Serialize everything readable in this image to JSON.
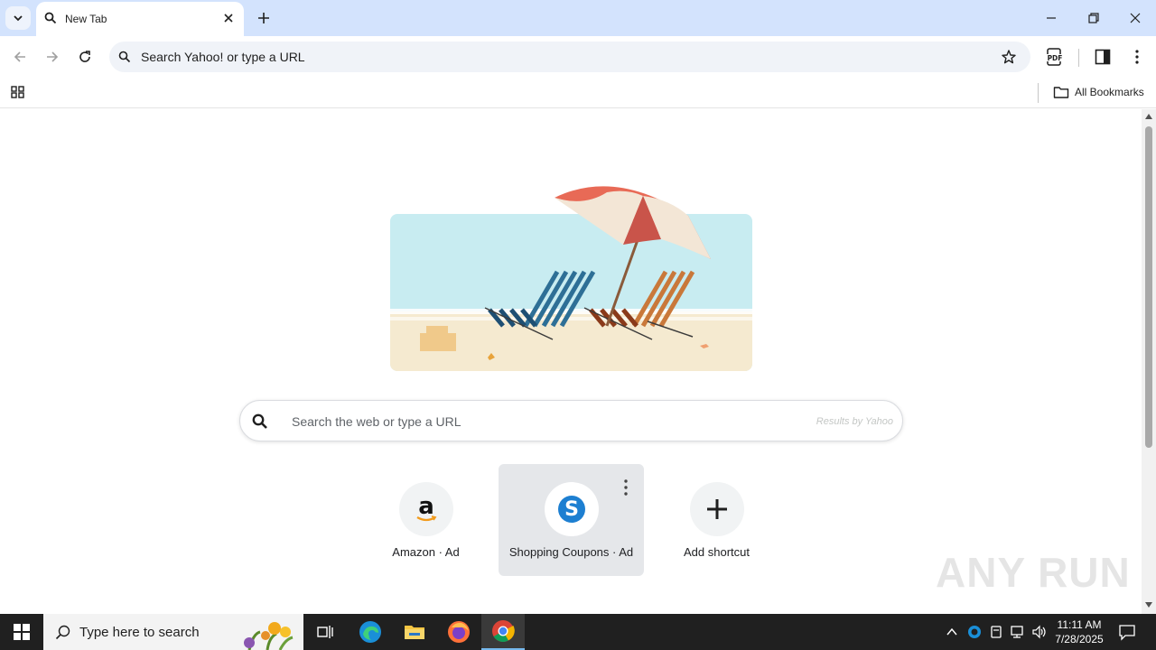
{
  "tabs": [
    {
      "title": "New Tab"
    }
  ],
  "omnibox": {
    "placeholder": "Search Yahoo! or type a URL"
  },
  "bookmarks_bar": {
    "all_bookmarks_label": "All Bookmarks"
  },
  "page": {
    "search_placeholder": "Search the web or type a URL",
    "results_by": "Results by Yahoo",
    "shortcuts": [
      {
        "label": "Amazon · Ad",
        "glyph": "a"
      },
      {
        "label": "Shopping Coupons · Ad",
        "glyph": "S"
      },
      {
        "label": "Add shortcut",
        "glyph": "+"
      }
    ]
  },
  "watermark": "ANY RUN",
  "taskbar": {
    "search_placeholder": "Type here to search",
    "time": "11:11 AM",
    "date": "7/28/2025"
  },
  "colors": {
    "tabstrip": "#d3e3fd",
    "taskbar": "#202020",
    "omnibox": "#f0f3f8"
  }
}
